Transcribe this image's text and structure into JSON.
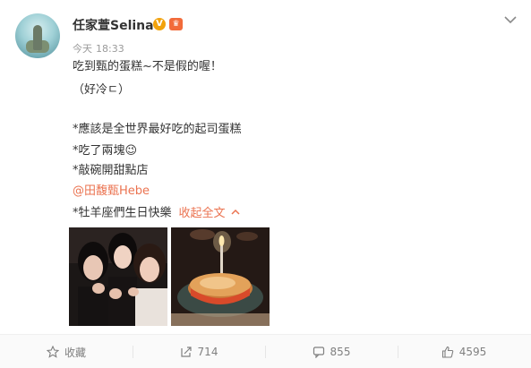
{
  "post": {
    "username": "任家萱Selina",
    "verified_badge": "V",
    "member_badge": "♛",
    "time_label": "今天",
    "time_value": "18:33",
    "lines": [
      "吃到甄的蛋糕~不是假的喔！",
      "（好冷ㄷ）",
      "*應該是全世界最好吃的起司蛋糕",
      "*吃了兩塊😉",
      "*敲碗開甜點店",
      "@田馥甄Hebe",
      "*牡羊座們生日快樂"
    ],
    "collapse_label": "收起全文"
  },
  "footer": {
    "favorite_label": "收藏",
    "repost_count": "714",
    "comment_count": "855",
    "like_count": "4595"
  },
  "colors": {
    "accent": "#eb7350",
    "text": "#333333",
    "muted": "#9a9a9a"
  }
}
